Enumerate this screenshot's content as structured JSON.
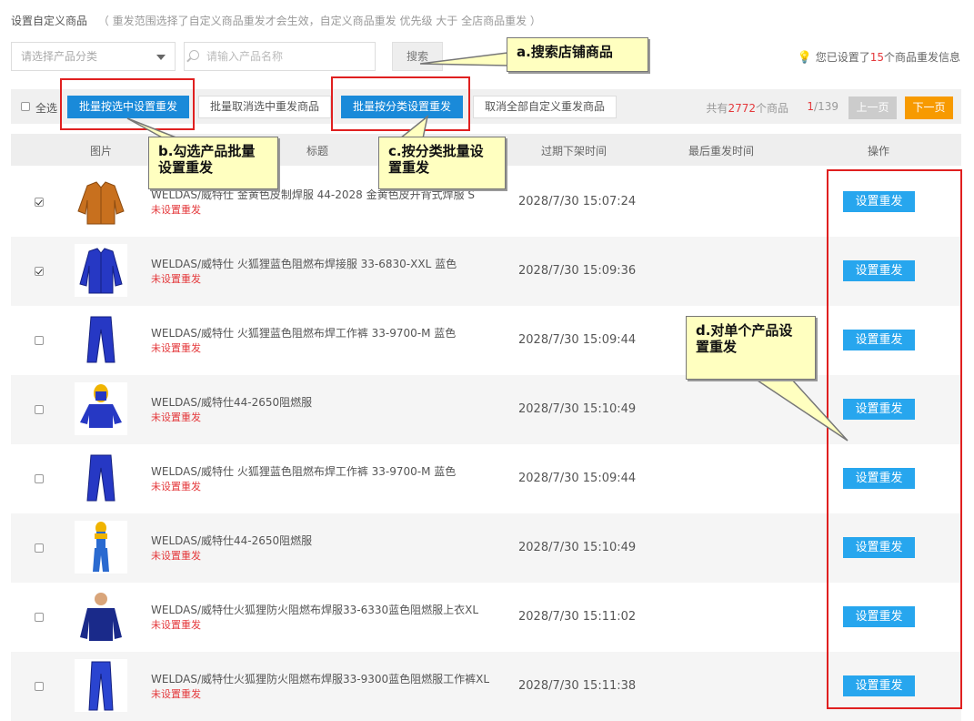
{
  "header": {
    "title": "设置自定义商品",
    "note": "（ 重发范围选择了自定义商品重发才会生效，自定义商品重发 优先级 大于 全店商品重发 ）"
  },
  "filters": {
    "category_placeholder": "请选择产品分类",
    "name_placeholder": "请输入产品名称",
    "search_label": "搜索",
    "stat_prefix": "您已设置了",
    "stat_count": "15",
    "stat_suffix": "个商品重发信息"
  },
  "toolbar": {
    "select_all": "全选",
    "batch_set": "批量按选中设置重发",
    "batch_cancel": "批量取消选中重发商品",
    "batch_category": "批量按分类设置重发",
    "cancel_all": "取消全部自定义重发商品",
    "total_prefix": "共有",
    "total_count": "2772",
    "total_suffix": "个商品",
    "page_current": "1",
    "page_total": "/139",
    "prev_label": "上一页",
    "next_label": "下一页"
  },
  "columns": {
    "image": "图片",
    "title": "标题",
    "expire": "过期下架时间",
    "last": "最后重发时间",
    "action": "操作"
  },
  "rows": [
    {
      "checked": true,
      "thumb": "brown-jacket",
      "title": "WELDAS/威特仕 金黄色皮制焊服 44-2028 金黄色皮开背式焊服 S",
      "status": "未设置重发",
      "expire": "2028/7/30 15:07:24",
      "action": "设置重发"
    },
    {
      "checked": true,
      "thumb": "blue-jacket",
      "title": "WELDAS/威特仕 火狐狸蓝色阻燃布焊接服 33-6830-XXL 蓝色",
      "status": "未设置重发",
      "expire": "2028/7/30 15:09:36",
      "action": "设置重发"
    },
    {
      "checked": false,
      "thumb": "blue-pants",
      "title": "WELDAS/威特仕 火狐狸蓝色阻燃布焊工作裤 33-9700-M 蓝色",
      "status": "未设置重发",
      "expire": "2028/7/30 15:09:44",
      "action": "设置重发"
    },
    {
      "checked": false,
      "thumb": "hood-jacket",
      "title": "WELDAS/威特仕44-2650阻燃服",
      "status": "未设置重发",
      "expire": "2028/7/30 15:10:49",
      "action": "设置重发"
    },
    {
      "checked": false,
      "thumb": "blue-pants",
      "title": "WELDAS/威特仕 火狐狸蓝色阻燃布焊工作裤 33-9700-M 蓝色",
      "status": "未设置重发",
      "expire": "2028/7/30 15:09:44",
      "action": "设置重发"
    },
    {
      "checked": false,
      "thumb": "hood-suit",
      "title": "WELDAS/威特仕44-2650阻燃服",
      "status": "未设置重发",
      "expire": "2028/7/30 15:10:49",
      "action": "设置重发"
    },
    {
      "checked": false,
      "thumb": "man-jacket",
      "title": "WELDAS/威特仕火狐狸防火阻燃布焊服33-6330蓝色阻燃服上衣XL",
      "status": "未设置重发",
      "expire": "2028/7/30 15:11:02",
      "action": "设置重发"
    },
    {
      "checked": false,
      "thumb": "blue-pants2",
      "title": "WELDAS/威特仕火狐狸防火阻燃布焊服33-9300蓝色阻燃服工作裤XL",
      "status": "未设置重发",
      "expire": "2028/7/30 15:11:38",
      "action": "设置重发"
    }
  ],
  "annotations": {
    "a": "a.搜索店铺商品",
    "b": "b.勾选产品批量设置重发",
    "c": "c.按分类批量设置重发",
    "d": "d.对单个产品设置重发"
  },
  "colors": {
    "accent": "#1a8ad9",
    "action": "#27a6ee",
    "next": "#f79a00",
    "status": "#e4393c"
  }
}
